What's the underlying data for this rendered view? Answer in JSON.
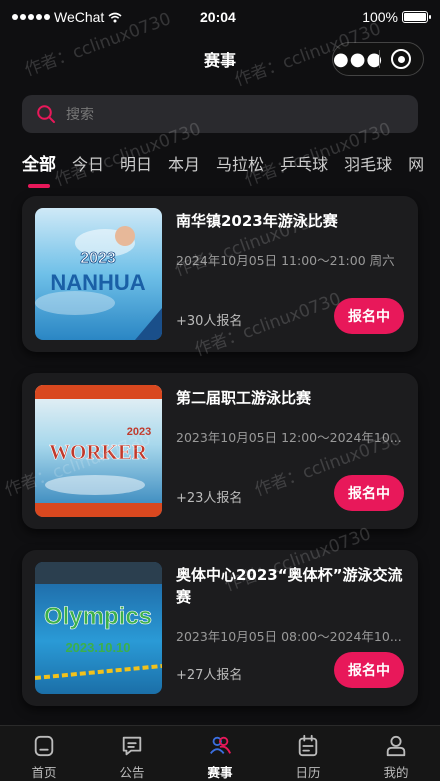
{
  "status_bar": {
    "carrier": "WeChat",
    "time": "20:04",
    "battery": "100%"
  },
  "nav": {
    "title": "赛事",
    "more_icon": "more-dots-icon",
    "close_icon": "target-close-icon"
  },
  "search": {
    "placeholder": "搜索",
    "icon": "search-icon",
    "accent": "#e8185a"
  },
  "tabs": [
    {
      "label": "全部",
      "active": true
    },
    {
      "label": "今日"
    },
    {
      "label": "明日"
    },
    {
      "label": "本月"
    },
    {
      "label": "马拉松"
    },
    {
      "label": "乒乓球"
    },
    {
      "label": "羽毛球"
    },
    {
      "label": "网"
    }
  ],
  "events": [
    {
      "title": "南华镇2023年游泳比赛",
      "time": "2024年10月05日 11:00～21:00 周六",
      "count": "+30人报名",
      "button": "报名中",
      "poster_line1": "2023",
      "poster_line2": "NANHUA"
    },
    {
      "title": "第二届职工游泳比赛",
      "time": "2023年10月05日 12:00～2024年10...",
      "count": "+23人报名",
      "button": "报名中",
      "poster_line1": "2023",
      "poster_line2": "WORKER"
    },
    {
      "title": "奥体中心2023“奥体杯”游泳交流赛",
      "time": "2023年10月05日 08:00～2024年10...",
      "count": "+27人报名",
      "button": "报名中",
      "poster_line1": "Olympics",
      "poster_line2": "2023.10.10"
    }
  ],
  "tab_bar": [
    {
      "label": "首页",
      "icon": "home-icon"
    },
    {
      "label": "公告",
      "icon": "notice-icon"
    },
    {
      "label": "赛事",
      "icon": "users-icon",
      "active": true
    },
    {
      "label": "日历",
      "icon": "calendar-icon"
    },
    {
      "label": "我的",
      "icon": "profile-icon"
    }
  ],
  "watermark": "作者：cclinux0730",
  "colors": {
    "accent": "#e8185a",
    "background": "#0f0f11",
    "card": "#1c1c1e"
  }
}
